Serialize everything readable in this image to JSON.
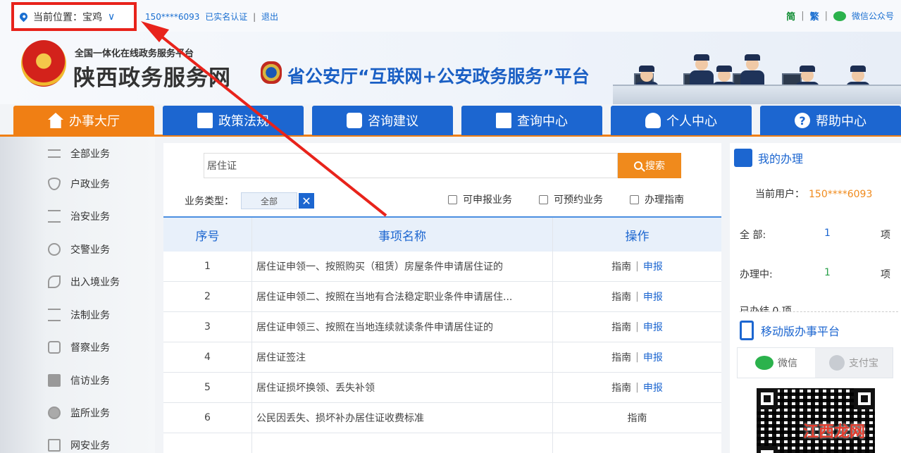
{
  "topbar": {
    "location_label": "当前位置：宝鸡",
    "user_phone": "150****6093",
    "verified": "已实名认证",
    "separator": "|",
    "logout": "退出",
    "lang_simplified": "简",
    "lang_traditional": "繁",
    "wechat_account": "微信公众号"
  },
  "header": {
    "platform": "全国一体化在线政务服务平台",
    "site_title": "陕西政务服务网",
    "slogan": "省公安厅“互联网+公安政务服务”平台"
  },
  "nav": {
    "tabs": [
      {
        "label": "办事大厅",
        "icon": "home-icon"
      },
      {
        "label": "政策法规",
        "icon": "document-icon"
      },
      {
        "label": "咨询建议",
        "icon": "chat-icon"
      },
      {
        "label": "查询中心",
        "icon": "search-doc-icon"
      },
      {
        "label": "个人中心",
        "icon": "person-icon"
      },
      {
        "label": "帮助中心",
        "icon": "help-icon"
      }
    ]
  },
  "sidebar": {
    "items": [
      {
        "label": "全部业务",
        "icon": "list-icon"
      },
      {
        "label": "户政业务",
        "icon": "shield-icon"
      },
      {
        "label": "治安业务",
        "icon": "scale-icon"
      },
      {
        "label": "交警业务",
        "icon": "traffic-icon"
      },
      {
        "label": "出入境业务",
        "icon": "plane-icon"
      },
      {
        "label": "法制业务",
        "icon": "scale-icon"
      },
      {
        "label": "督察业务",
        "icon": "badge-icon"
      },
      {
        "label": "信访业务",
        "icon": "mail-icon"
      },
      {
        "label": "监所业务",
        "icon": "building-icon"
      },
      {
        "label": "网安业务",
        "icon": "monitor-icon"
      }
    ]
  },
  "search": {
    "value": "居住证",
    "button_label": "搜索"
  },
  "filter": {
    "type_label": "业务类型：",
    "type_value": "全部",
    "clear_label": "✕",
    "checkboxes": [
      "可申报业务",
      "可预约业务",
      "办理指南"
    ]
  },
  "table": {
    "headers": [
      "序号",
      "事项名称",
      "操作"
    ],
    "guide_label": "指南",
    "apply_label": "申报",
    "rows": [
      {
        "no": "1",
        "name": "居住证申领一、按照购买（租赁）房屋条件申请居住证的",
        "guide": "指南",
        "sep": "|",
        "apply": "申报"
      },
      {
        "no": "2",
        "name": "居住证申领二、按照在当地有合法稳定职业条件申请居住...",
        "guide": "指南",
        "sep": "|",
        "apply": "申报"
      },
      {
        "no": "3",
        "name": "居住证申领三、按照在当地连续就读条件申请居住证的",
        "guide": "指南",
        "sep": "|",
        "apply": "申报"
      },
      {
        "no": "4",
        "name": "居住证签注",
        "guide": "指南",
        "sep": "|",
        "apply": "申报"
      },
      {
        "no": "5",
        "name": "居住证损坏换领、丢失补领",
        "guide": "指南",
        "sep": "|",
        "apply": "申报"
      },
      {
        "no": "6",
        "name": "公民因丢失、损坏补办居住证收费标准",
        "guide": "指南",
        "sep": "",
        "apply": ""
      }
    ]
  },
  "right_panel": {
    "title": "我的办理",
    "current_user_label": "当前用户：",
    "current_user": "150****6093",
    "stats": [
      {
        "label": "全 部:",
        "value": "1",
        "unit": "项"
      },
      {
        "label": "办理中:",
        "value": "1",
        "unit": "项"
      }
    ],
    "partial_row": "已办结 0 项",
    "mobile_title": "移动版办事平台",
    "tab_wechat": "微信",
    "tab_alipay": "支付宝"
  },
  "watermark": "江西龙网",
  "colors": {
    "primary": "#1c66d0",
    "accent": "#f07f14",
    "highlight_box": "#e8231b"
  }
}
